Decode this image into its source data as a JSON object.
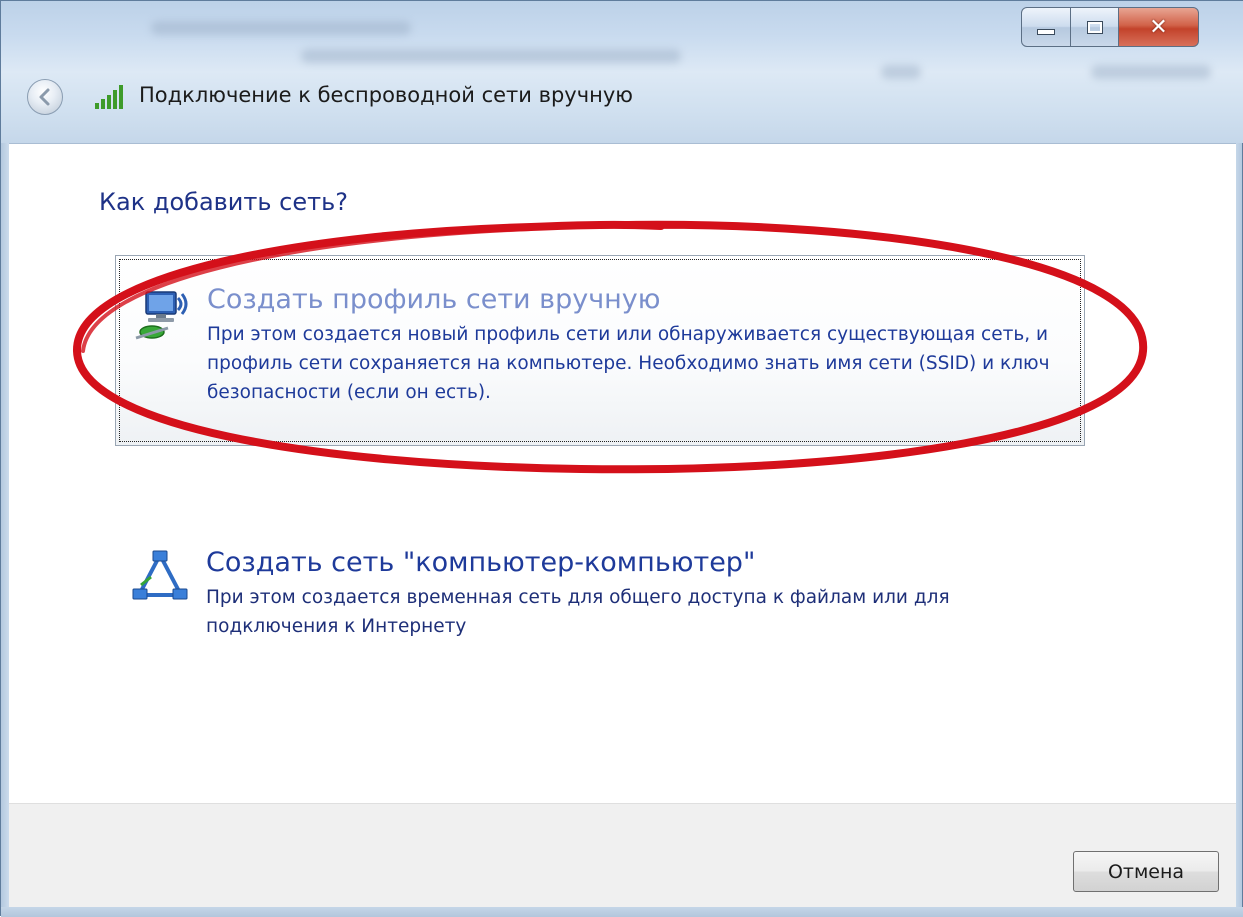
{
  "window": {
    "title": "Подключение к беспроводной сети вручную"
  },
  "main": {
    "heading": "Как добавить сеть?",
    "options": [
      {
        "title": "Создать профиль сети вручную",
        "description": "При этом создается новый профиль сети или обнаруживается существующая сеть, и профиль сети сохраняется на компьютере. Необходимо знать имя сети (SSID) и ключ безопасности (если он есть).",
        "icon": "wireless-network-profile-icon",
        "state": "focused"
      },
      {
        "title": "Создать сеть \"компьютер-компьютер\"",
        "description": "При этом создается временная сеть для общего доступа к файлам или для подключения к Интернету",
        "icon": "ad-hoc-network-icon"
      }
    ]
  },
  "footer": {
    "cancel_label": "Отмена"
  },
  "annotation": {
    "shape": "hand-drawn ellipse",
    "color": "#d4101a"
  }
}
